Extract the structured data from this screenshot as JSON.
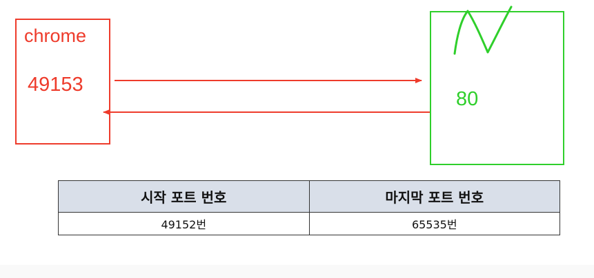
{
  "client": {
    "name": "chrome",
    "port": "49153"
  },
  "server": {
    "port": "80"
  },
  "port_table": {
    "headers": [
      "시작 포트 번호",
      "마지막 포트 번호"
    ],
    "values": [
      "49152번",
      "65535번"
    ]
  },
  "colors": {
    "client": "#ee3b2b",
    "server": "#2fcf2b",
    "header_bg": "#d9dfe9"
  }
}
